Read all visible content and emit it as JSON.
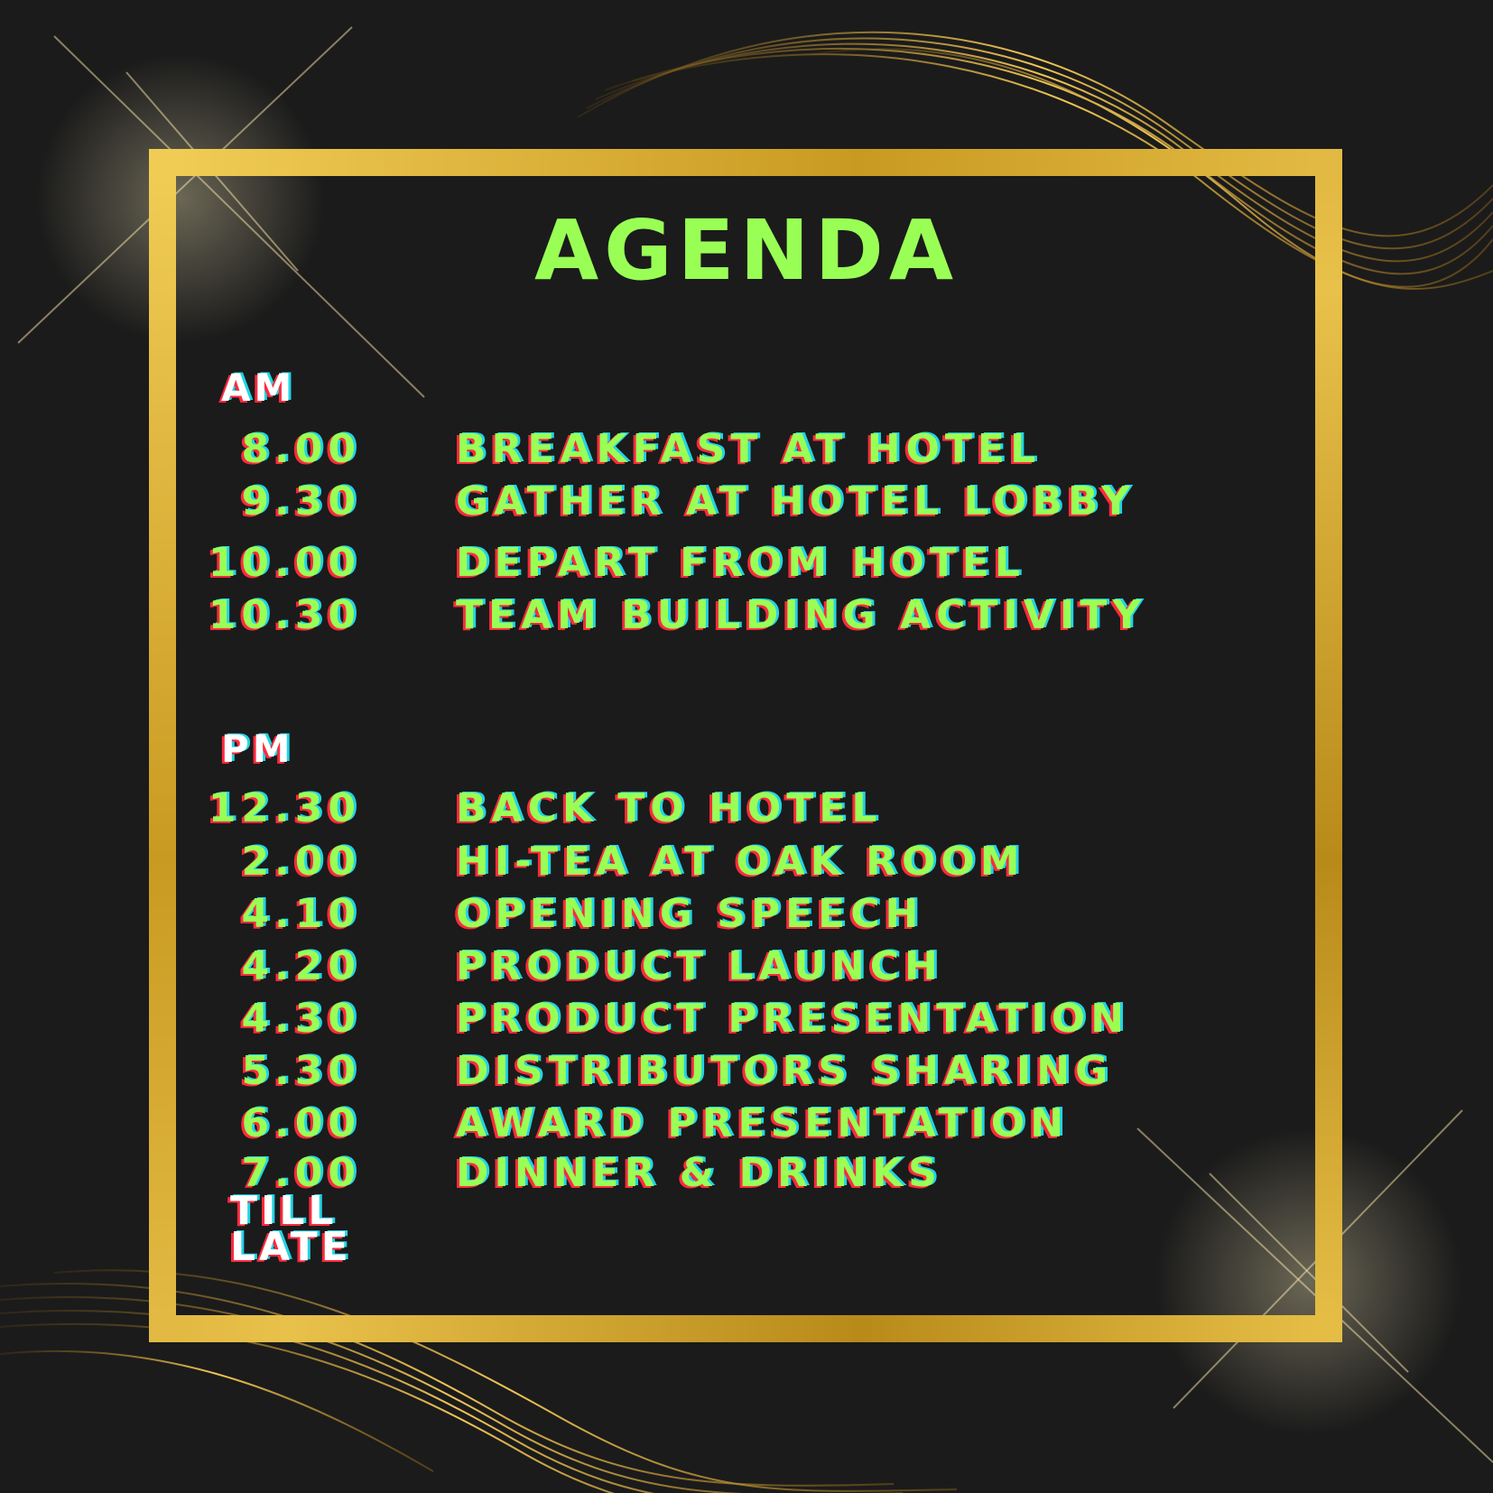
{
  "title": "AGENDA",
  "am": {
    "label": "AM",
    "items": [
      {
        "time": "8.00",
        "event": "BREAKFAST AT HOTEL"
      },
      {
        "time": "9.30",
        "event": "GATHER AT HOTEL LOBBY"
      },
      {
        "time": "10.00",
        "event": "DEPART FROM HOTEL"
      },
      {
        "time": "10.30",
        "event": "TEAM BUILDING ACTIVITY"
      }
    ]
  },
  "pm": {
    "label": "PM",
    "items": [
      {
        "time": "12.30",
        "event": "BACK TO HOTEL"
      },
      {
        "time": "2.00",
        "event": "HI-TEA AT OAK ROOM"
      },
      {
        "time": "4.10",
        "event": "OPENING SPEECH"
      },
      {
        "time": "4.20",
        "event": "PRODUCT LAUNCH"
      },
      {
        "time": "4.30",
        "event": "PRODUCT PRESENTATION"
      },
      {
        "time": "5.30",
        "event": "DISTRIBUTORS SHARING"
      },
      {
        "time": "6.00",
        "event": "AWARD PRESENTATION"
      },
      {
        "time": "7.00",
        "event": "DINNER & DRINKS"
      }
    ]
  },
  "till_late": [
    "TILL",
    "LATE"
  ],
  "colors": {
    "background": "#1b1b1b",
    "gold": "#d4a62a",
    "accent_green": "#99ff55",
    "glitch_red": "#ff2a3d",
    "glitch_cyan": "#22d3e6"
  }
}
